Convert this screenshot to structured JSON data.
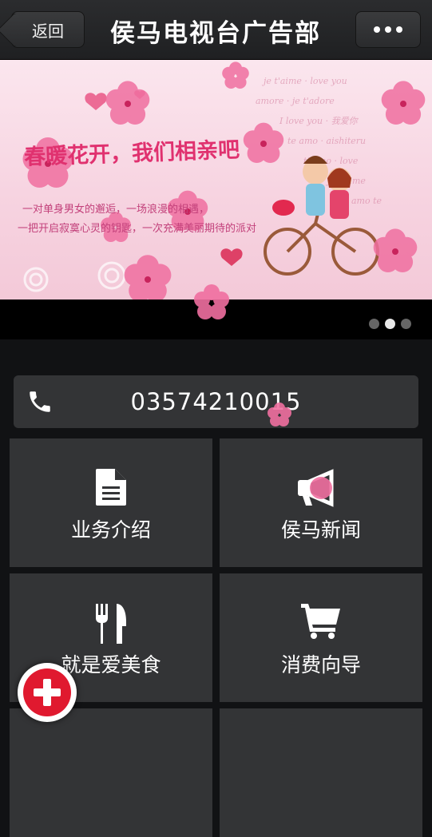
{
  "header": {
    "back_label": "返回",
    "title": "侯马电视台广告部",
    "more_icon": "more-dots-icon"
  },
  "banner": {
    "headline": "春暖花开，我们相亲吧",
    "line1": "一对单身男女的邂逅，一场浪漫的相遇，",
    "line2": "一把开启寂寞心灵的钥匙，一次充满美丽期待的派对",
    "slide_count": 3,
    "active_slide": 2
  },
  "phone": {
    "icon": "phone-icon",
    "number": "03574210015"
  },
  "tiles": [
    {
      "label": "业务介绍",
      "icon": "document-icon"
    },
    {
      "label": "侯马新闻",
      "icon": "megaphone-icon"
    },
    {
      "label": "就是爱美食",
      "icon": "fork-knife-icon"
    },
    {
      "label": "消费向导",
      "icon": "shopping-cart-icon"
    }
  ],
  "fab": {
    "icon": "plus-icon"
  },
  "colors": {
    "accent": "#e0192f",
    "tile_bg": "#333436",
    "page_bg": "#111214",
    "pink": "#e0316f"
  }
}
